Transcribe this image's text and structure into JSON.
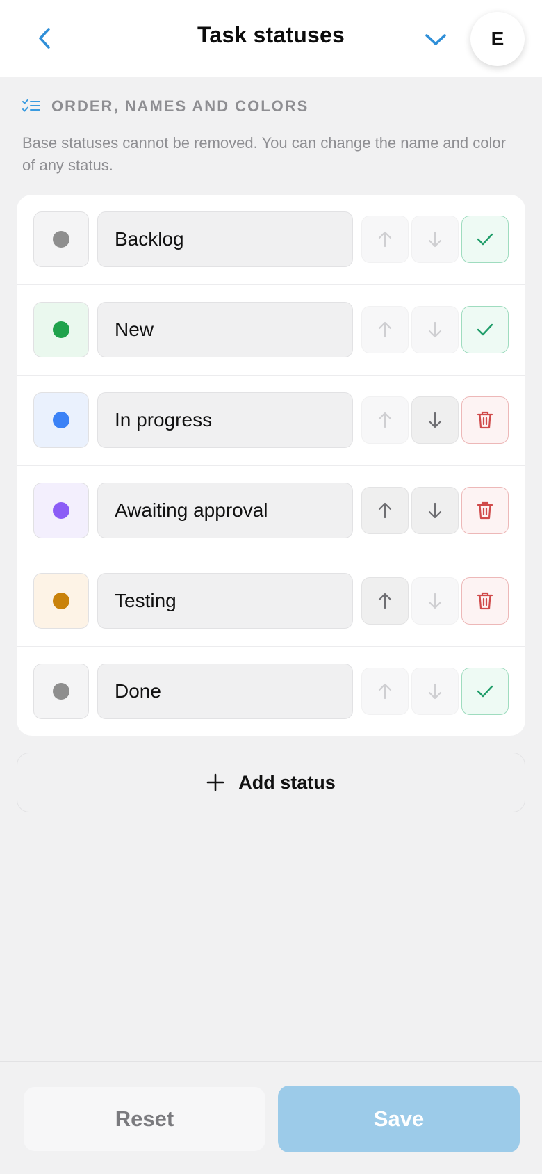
{
  "header": {
    "title": "Task statuses",
    "avatar_initial": "E",
    "accent_color": "#2f8fd8"
  },
  "section": {
    "title": "ORDER, NAMES AND COLORS",
    "icon": "checklist-icon",
    "description": "Base statuses cannot be removed. You can change the name and color of any status."
  },
  "statuses": [
    {
      "name": "Backlog",
      "color": "#8e8e8e",
      "swatch_bg": "#f4f4f5",
      "up_enabled": false,
      "down_enabled": false,
      "action": "check"
    },
    {
      "name": "New",
      "color": "#1fa24b",
      "swatch_bg": "#eaf8ee",
      "up_enabled": false,
      "down_enabled": false,
      "action": "check"
    },
    {
      "name": "In progress",
      "color": "#3b82f6",
      "swatch_bg": "#eaf1fd",
      "up_enabled": false,
      "down_enabled": true,
      "action": "delete"
    },
    {
      "name": "Awaiting approval",
      "color": "#8b5cf6",
      "swatch_bg": "#f3effd",
      "up_enabled": true,
      "down_enabled": true,
      "action": "delete"
    },
    {
      "name": "Testing",
      "color": "#c9820b",
      "swatch_bg": "#fdf3e6",
      "up_enabled": true,
      "down_enabled": false,
      "action": "delete"
    },
    {
      "name": "Done",
      "color": "#8e8e8e",
      "swatch_bg": "#f4f4f5",
      "up_enabled": false,
      "down_enabled": false,
      "action": "check"
    }
  ],
  "add_status_label": "Add status",
  "footer": {
    "reset_label": "Reset",
    "save_label": "Save"
  }
}
